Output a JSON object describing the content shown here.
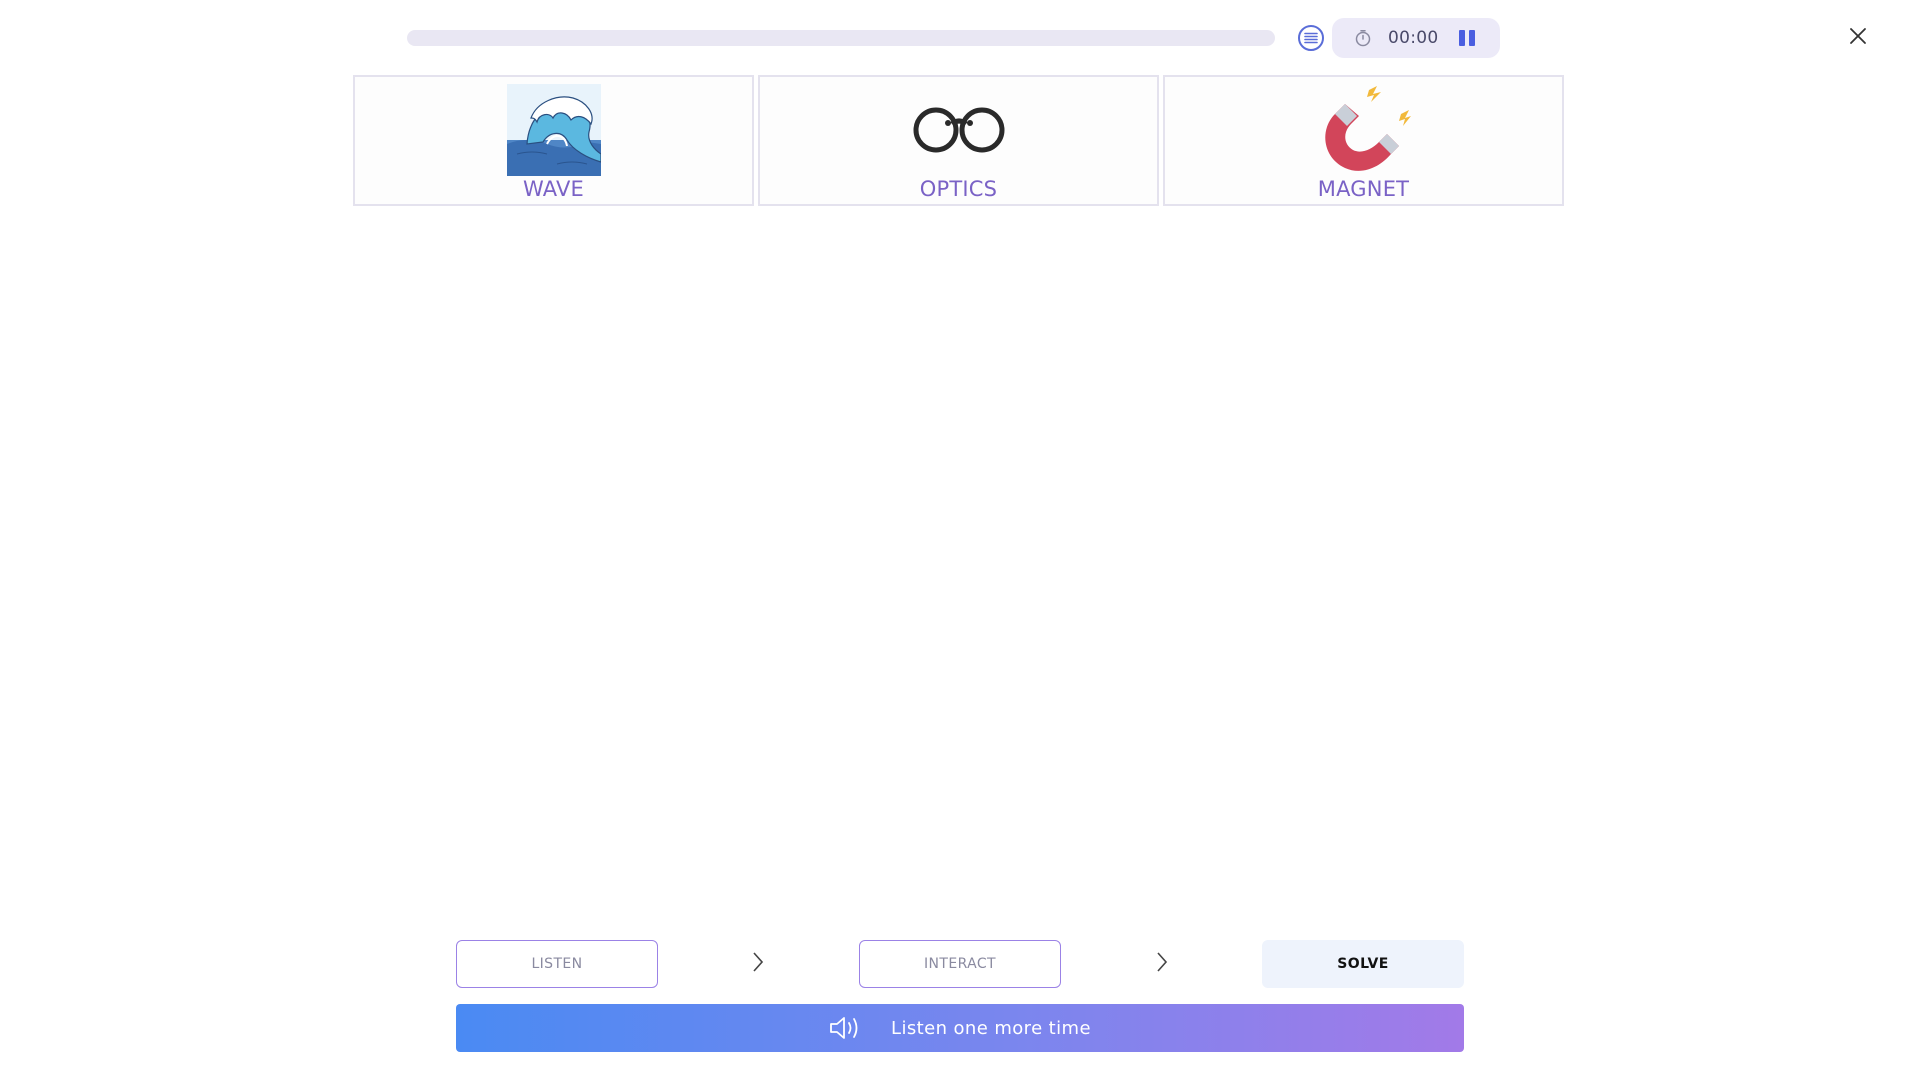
{
  "progress": {
    "value": 0
  },
  "timer": {
    "time": "00:00"
  },
  "icons": {
    "list": "list-icon",
    "timer": "stopwatch-icon",
    "pause": "pause-icon",
    "close": "close-icon",
    "speaker": "speaker-icon",
    "chevron": "chevron-right-icon"
  },
  "cards": [
    {
      "label": "WAVE",
      "image": "wave-image"
    },
    {
      "label": "OPTICS",
      "image": "glasses-image"
    },
    {
      "label": "MAGNET",
      "image": "magnet-image"
    }
  ],
  "steps": {
    "listen": "LISTEN",
    "interact": "INTERACT",
    "solve": "SOLVE"
  },
  "listen_again": {
    "label": "Listen one more time"
  },
  "colors": {
    "accent": "#7a62c6",
    "step_border": "#9b82e6",
    "gradient_start": "#4a8af3",
    "gradient_end": "#a27ae8",
    "magnet_red": "#d2455a"
  }
}
